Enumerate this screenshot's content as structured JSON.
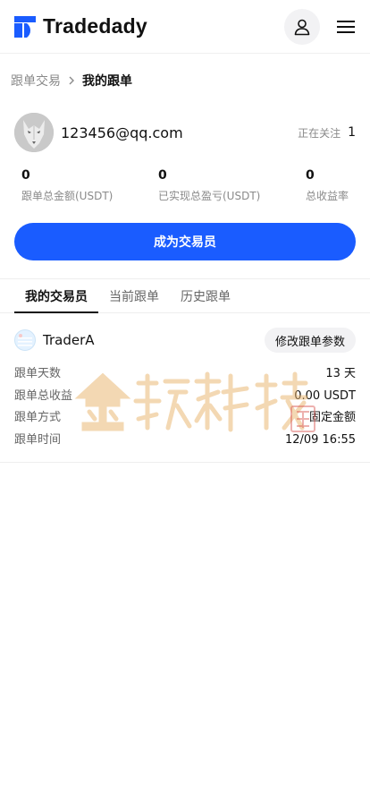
{
  "header": {
    "logo_icon": "tradedady-logo-icon",
    "brand": "Tradedady",
    "user_icon": "user-icon",
    "menu_icon": "hamburger-menu-icon"
  },
  "breadcrumb": {
    "parent": "跟单交易",
    "separator_icon": "chevron-right-icon",
    "current": "我的跟单"
  },
  "profile": {
    "avatar_icon": "wolf-avatar-image",
    "email": "123456@qq.com",
    "following_label": "正在关注",
    "following_count": "1"
  },
  "stats": [
    {
      "value": "0",
      "label": "跟单总金额(USDT)"
    },
    {
      "value": "0",
      "label": "已实现总盈亏(USDT)"
    },
    {
      "value": "0",
      "label": "总收益率"
    }
  ],
  "cta_label": "成为交易员",
  "tabs": [
    {
      "label": "我的交易员",
      "active": true
    },
    {
      "label": "当前跟单",
      "active": false
    },
    {
      "label": "历史跟单",
      "active": false
    }
  ],
  "trader": {
    "name": "TraderA",
    "edit_label": "修改跟单参数",
    "rows": [
      {
        "label": "跟单天数",
        "value": "13 天"
      },
      {
        "label": "跟单总收益",
        "value": "0.00 USDT"
      },
      {
        "label": "跟单方式",
        "value": "固定金额"
      },
      {
        "label": "跟单时间",
        "value": "12/09 16:55"
      }
    ]
  },
  "watermark": {
    "text": "金 玹 科 技",
    "seal_text": "印章"
  },
  "colors": {
    "accent": "#1a5cff",
    "muted": "#8a8a8a",
    "chip_bg": "#f2f2f4",
    "watermark_gold": "#e8b26a"
  }
}
